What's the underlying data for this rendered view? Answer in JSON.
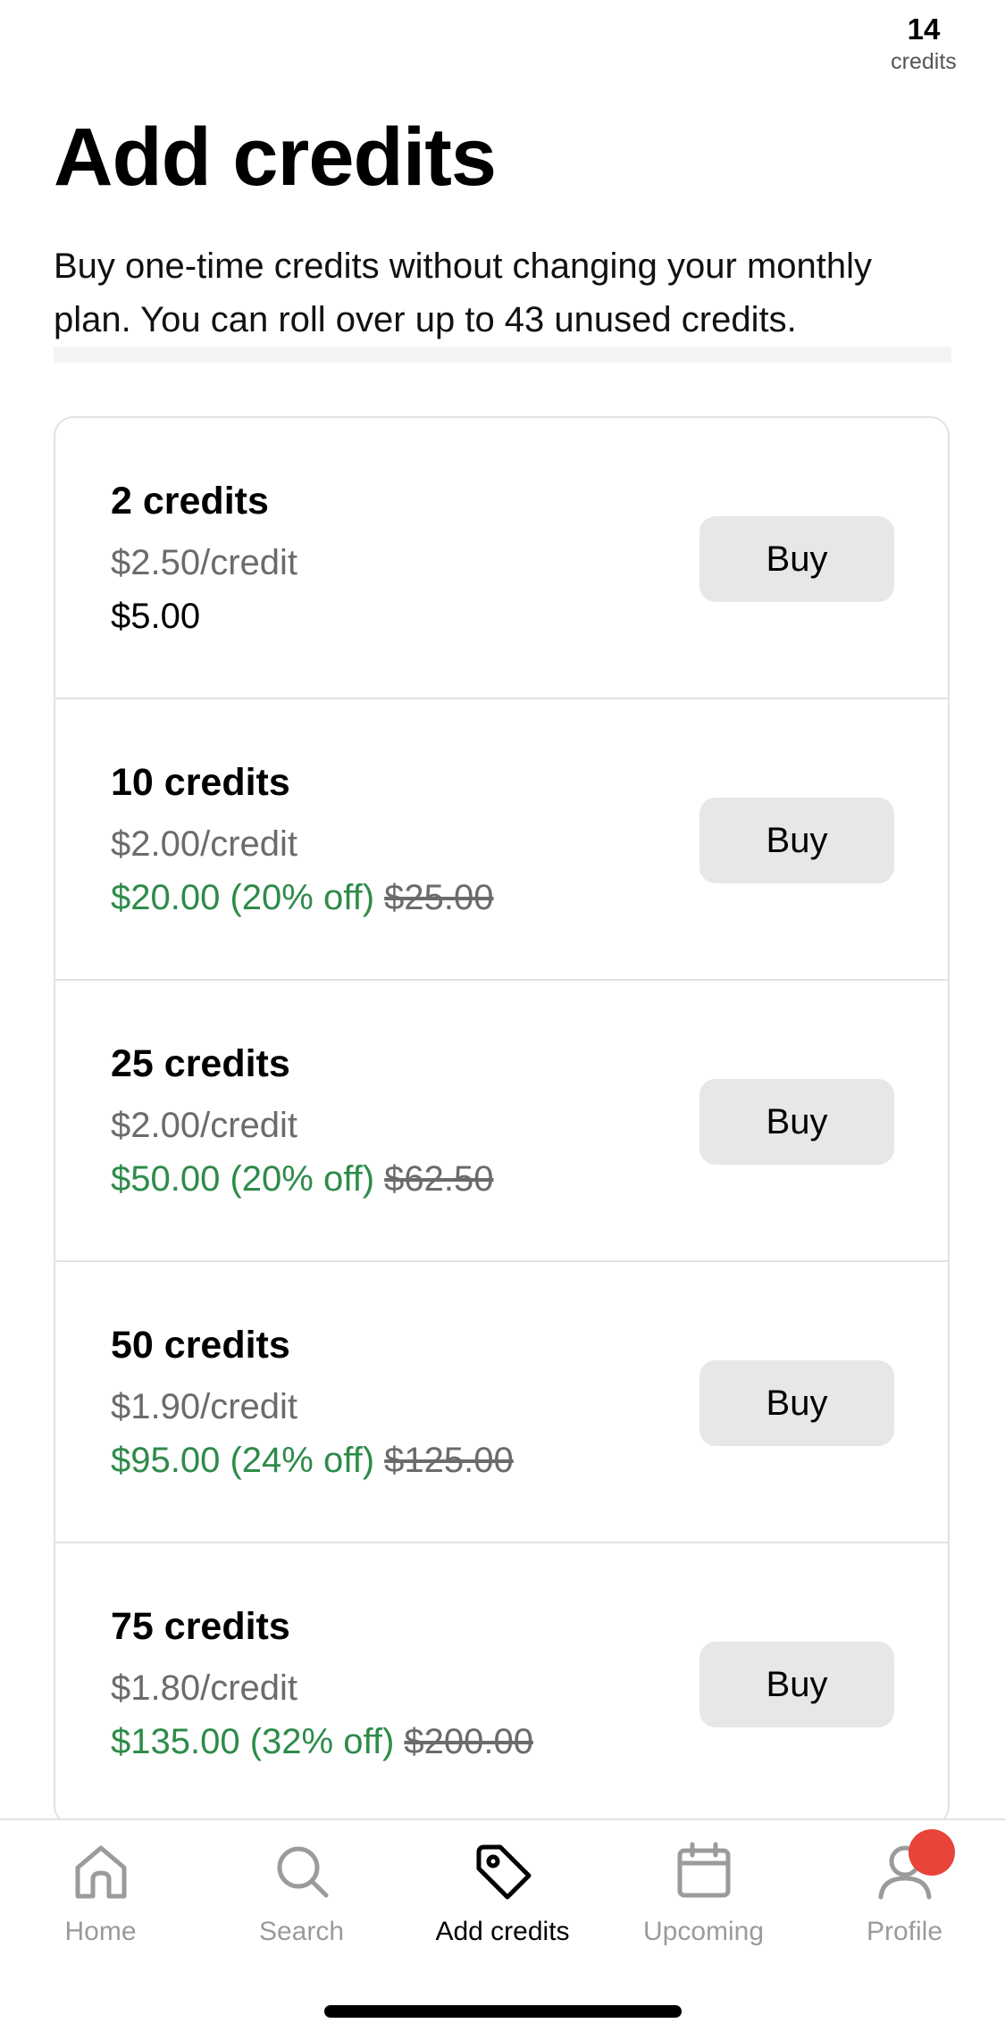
{
  "header": {
    "credits_count": "14",
    "credits_unit": "credits",
    "title": "Add credits",
    "subtitle": "Buy one-time credits without changing your monthly plan. You can roll over up to 43 unused credits."
  },
  "packages": [
    {
      "name": "2 credits",
      "rate": "$2.50/credit",
      "total": "$5.00",
      "discount": "",
      "original": "",
      "button": "Buy"
    },
    {
      "name": "10 credits",
      "rate": "$2.00/credit",
      "total": "$20.00",
      "discount": "(20% off)",
      "original": "$25.00",
      "button": "Buy"
    },
    {
      "name": "25 credits",
      "rate": "$2.00/credit",
      "total": "$50.00",
      "discount": "(20% off)",
      "original": "$62.50",
      "button": "Buy"
    },
    {
      "name": "50 credits",
      "rate": "$1.90/credit",
      "total": "$95.00",
      "discount": "(24% off)",
      "original": "$125.00",
      "button": "Buy"
    },
    {
      "name": "75 credits",
      "rate": "$1.80/credit",
      "total": "$135.00",
      "discount": "(32% off)",
      "original": "$200.00",
      "button": "Buy"
    }
  ],
  "tabs": [
    {
      "label": "Home",
      "icon": "home-icon",
      "active": false
    },
    {
      "label": "Search",
      "icon": "search-icon",
      "active": false
    },
    {
      "label": "Add credits",
      "icon": "tag-icon",
      "active": true
    },
    {
      "label": "Upcoming",
      "icon": "calendar-icon",
      "active": false
    },
    {
      "label": "Profile",
      "icon": "profile-icon",
      "active": false
    }
  ],
  "colors": {
    "discount_green": "#2e8b4a",
    "muted_gray": "#6b6b6b",
    "button_bg": "#e7e7e7",
    "notification_red": "#e8443a"
  }
}
